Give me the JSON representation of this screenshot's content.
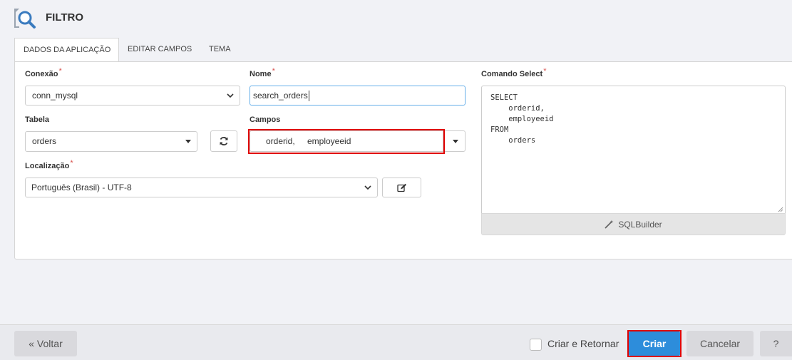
{
  "header": {
    "title": "FILTRO",
    "icon": "search-document-icon"
  },
  "tabs": [
    {
      "label": "DADOS DA APLICAÇÃO",
      "active": true
    },
    {
      "label": "EDITAR CAMPOS",
      "active": false
    },
    {
      "label": "TEMA",
      "active": false
    }
  ],
  "form": {
    "conexao": {
      "label": "Conexão",
      "required": "*",
      "value": "conn_mysql"
    },
    "nome": {
      "label": "Nome",
      "required": "*",
      "value": "search_orders"
    },
    "tabela": {
      "label": "Tabela",
      "value": "orders"
    },
    "campos": {
      "label": "Campos",
      "values": [
        "orderid,",
        "employeeid"
      ]
    },
    "localizacao": {
      "label": "Localização",
      "required": "*",
      "value": "Português (Brasil) - UTF-8"
    },
    "comando": {
      "label": "Comando Select",
      "required": "*",
      "sql": "SELECT\n    orderid,\n    employeeid\nFROM\n    orders",
      "builder_label": "SQLBuilder"
    }
  },
  "footer": {
    "back_label": "« Voltar",
    "criar_retornar_label": "Criar e Retornar",
    "criar_label": "Criar",
    "cancelar_label": "Cancelar",
    "help_label": "?"
  },
  "colors": {
    "primary": "#2d8ddb",
    "highlight": "#e00000",
    "required": "#d9534f"
  }
}
